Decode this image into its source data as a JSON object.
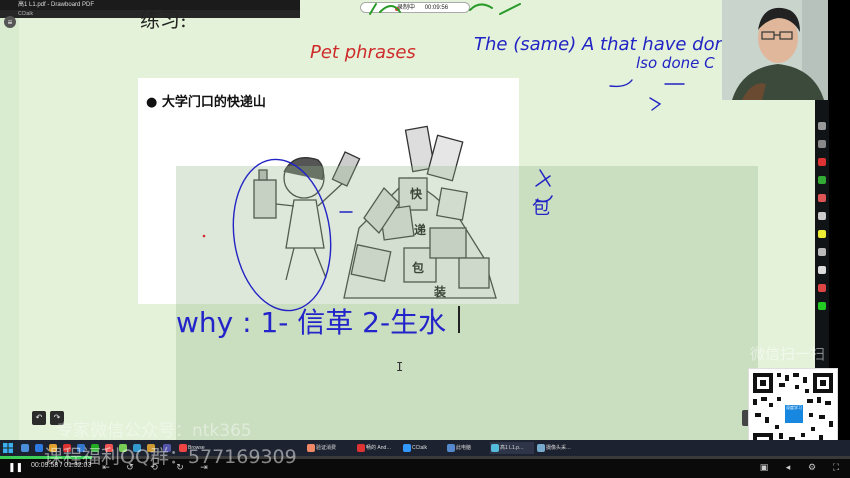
{
  "window": {
    "title": "高1 L1.pdf - Drawboard PDF",
    "tab": "CCtalk"
  },
  "recording": {
    "label": "录制中",
    "time": "00:09:56"
  },
  "slide": {
    "heading": "练习:",
    "bullet": "大学门口的快递山",
    "box_labels": [
      "快",
      "递",
      "包",
      "装"
    ]
  },
  "handwriting": {
    "pet_phrases": "Pet phrases",
    "line1": "The (same) A that have done B",
    "line2": "lso done C",
    "bao": "包"
  },
  "textbox": {
    "text": "why : 1- 信革 2-生水"
  },
  "watermarks": {
    "wm1": "专家微信公众号：ntk365",
    "wm2": "课程福利QQ群：577169309",
    "wm3": "微信扫一扫"
  },
  "qr": {
    "center_text": "深度学习"
  },
  "taskbar": {
    "items": [
      {
        "label": "Browse",
        "color": "#e44"
      },
      {
        "label": "验证消费",
        "color": "#e86"
      },
      {
        "label": "畅的 And…",
        "color": "#d33"
      },
      {
        "label": "CCtalk",
        "color": "#39f"
      },
      {
        "label": "此电脑",
        "color": "#58c"
      },
      {
        "label": "高1 L1.p…",
        "color": "#5bd"
      },
      {
        "label": "摄像头采…",
        "color": "#7ac"
      }
    ]
  },
  "player": {
    "current": "00:09:58",
    "total": "01:32:03",
    "progress": 0.108
  },
  "colors": {
    "ink_red": "#cf2b2b",
    "ink_blue": "#2223c4",
    "canvas": "#e3f2d9"
  },
  "icons": {
    "menu": "menu-icon",
    "play": "play-icon",
    "undo": "undo-icon",
    "redo": "redo-icon"
  }
}
